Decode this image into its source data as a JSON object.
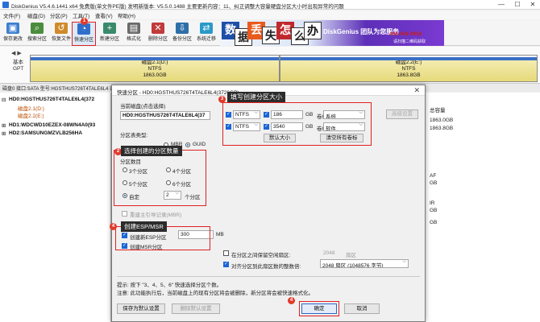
{
  "window": {
    "title": "DiskGenius V5.4.6.1441 x64 免费版(单文件PE版)   发明新版本: V5.5.0.1488   主要更新内容：11、纠正调整大容量硬盘分区大小时出现异常的问题"
  },
  "menu": [
    "文件(F)",
    "磁盘(D)",
    "分区(P)",
    "工具(T)",
    "查看(V)",
    "帮助(H)"
  ],
  "toolbar": [
    "保存更改",
    "搜索分区",
    "恢复文件",
    "快速分区",
    "新建分区",
    "格式化",
    "删除分区",
    "备份分区",
    "系统迁移"
  ],
  "banner": {
    "tiles": [
      "数",
      "据",
      "丢",
      "失",
      "怎",
      "么",
      "办"
    ],
    "slogan": "DiskGenius 团队为您服务",
    "phone": "400-008-9958",
    "web": "请扫描二维码获取"
  },
  "disk_map": {
    "nav": "◀ ▶",
    "basic": "基本",
    "gpt": "GPT",
    "partitions": [
      {
        "name": "磁盘2.1(D:)",
        "fs": "NTFS",
        "size": "1863.0GB"
      },
      {
        "name": "磁盘2.2(E:)",
        "fs": "NTFS",
        "size": "1863.8GB"
      }
    ]
  },
  "disk_info": "磁盘0 接口:SATA  型号:HGSTHUS726T4TALE6L4  容量:3726.0GB(3815447MB)  柱面数:486401  磁头数:255  每道扇区数:63  总扇区数:7814037168",
  "tree": [
    "HD0:HGSTHUS726T4TALE6L4(372",
    "磁盘2.1(D:)",
    "磁盘2.2(E:)",
    "HD1:WDCWD10EZEX-08WN4A0(93",
    "HD2:SAMSUNGMZVLB256HA"
  ],
  "right_panel": [
    "总容量",
    "1863.0GB",
    "1863.8GB",
    "",
    "AF",
    "GB",
    "IR",
    "GB",
    "GB"
  ],
  "dialog": {
    "title": "快速分区 - HD0:HGSTHUS726T4TALE6L4(3726GB)",
    "close": "✕",
    "current_disk_label": "当前磁盘(点击选择)",
    "current_disk_value": "HD0:HGSTHUS726T4TALE6L4(37",
    "partition_table_label": "分区表类型:",
    "mbr": "MBR",
    "guid": "GUID",
    "count_label": "分区数目",
    "count_options": [
      "3个分区",
      "4个分区",
      "5个分区",
      "6个分区",
      "自定",
      "个分区"
    ],
    "custom_value": "2",
    "rebuild_mbr": "重建主引导记录(MBR)",
    "esp_label": "创建新ESP分区",
    "esp_size": "300",
    "esp_unit": "MB",
    "msr_label": "创建MSR分区",
    "rows": [
      {
        "fs": "NTFS",
        "size": "186",
        "unit": "GB",
        "vol_label": "卷标:",
        "volume": "系统"
      },
      {
        "fs": "NTFS",
        "size": "3540",
        "unit": "GB",
        "vol_label": "卷标:",
        "volume": "软件"
      }
    ],
    "default_size": "默认大小",
    "clear_labels": "清空所有卷标",
    "freespace_label": "在分区之间保留空闲扇区:",
    "freespace_value": "2048",
    "freespace_unit": "扇区",
    "align_label": "对齐分区到此扇区数的整数倍:",
    "align_value": "2048 扇区 (1048576 字节)",
    "advanced": "高级设置",
    "tip1": "提示: 按下 \"3、4、5、6\" 快速选择分区个数。",
    "tip2": "注意: 此功能执行后，当前磁盘上的现有分区将会被删除，新分区将会被快速格式化。",
    "save_default": "保存为默认设置",
    "delete_default": "删除默认设置",
    "ok": "确定",
    "cancel": "取消"
  },
  "callouts": {
    "c1": "快速分区",
    "c2": "选择创建的分区数量",
    "c3": "填写创建分区大小",
    "c4": "创建ESP/MSR"
  },
  "badges": [
    "1",
    "2",
    "3",
    "4",
    "4"
  ],
  "colors": {
    "accent": "#e02020",
    "callout_bg": "#2c2c2c",
    "selection": "#1a66d6",
    "partition": "#e6d97a",
    "partition_header": "#3b6fc7"
  }
}
